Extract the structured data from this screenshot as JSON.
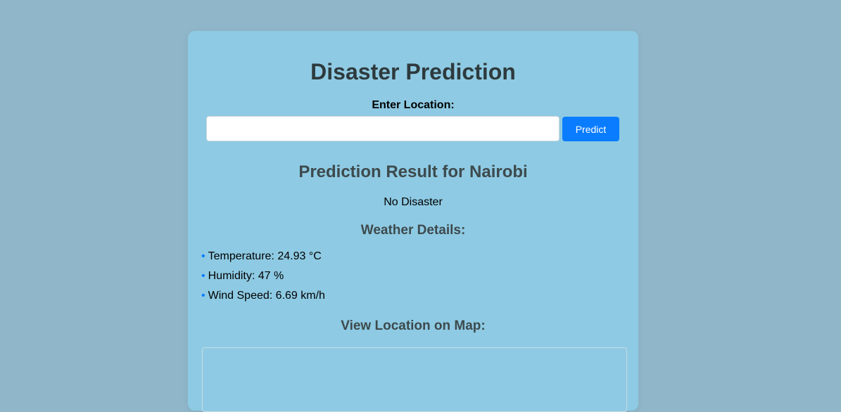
{
  "page": {
    "title": "Disaster Prediction"
  },
  "form": {
    "label": "Enter Location:",
    "input_value": "",
    "button_label": "Predict"
  },
  "result": {
    "title": "Prediction Result for Nairobi",
    "value": "No Disaster"
  },
  "weather": {
    "title": "Weather Details:",
    "items": [
      {
        "bullet": "•",
        "text": "Temperature: 24.93 °C"
      },
      {
        "bullet": "•",
        "text": "Humidity: 47 %"
      },
      {
        "bullet": "•",
        "text": "Wind Speed: 6.69 km/h"
      }
    ]
  },
  "map": {
    "title": "View Location on Map:"
  },
  "colors": {
    "page_background": "#8fb7c9",
    "card_background": "#8ecae3",
    "accent": "#0a7cff"
  }
}
